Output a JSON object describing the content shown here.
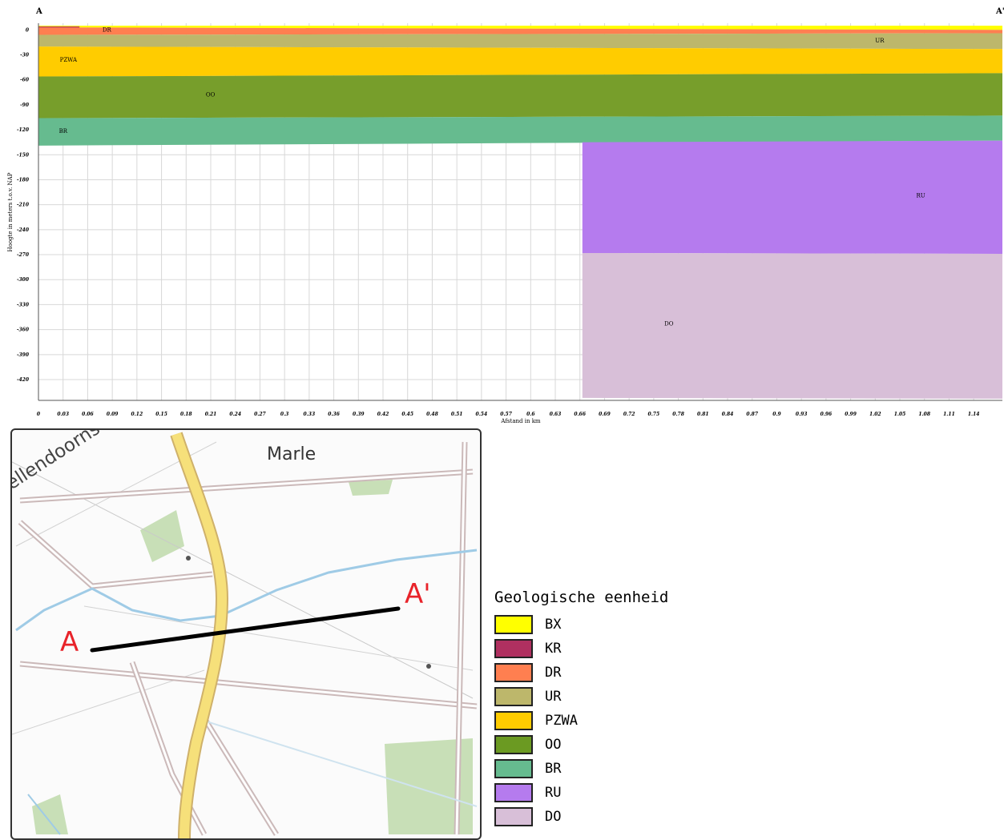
{
  "chart_data": {
    "type": "area",
    "title": "",
    "xlabel": "Afstand in km",
    "ylabel": "Hoogte in meters t.o.v. NAP",
    "xlim": [
      0,
      1.175
    ],
    "ylim": [
      -445,
      8
    ],
    "grid": true,
    "start_label": "A",
    "end_label": "A'",
    "x_ticks": [
      "0",
      "0.03",
      "0.06",
      "0.09",
      "0.12",
      "0.15",
      "0.18",
      "0.21",
      "0.24",
      "0.27",
      "0.3",
      "0.33",
      "0.36",
      "0.39",
      "0.42",
      "0.45",
      "0.48",
      "0.51",
      "0.54",
      "0.57",
      "0.6",
      "0.63",
      "0.66",
      "0.69",
      "0.72",
      "0.75",
      "0.78",
      "0.81",
      "0.84",
      "0.87",
      "0.9",
      "0.93",
      "0.96",
      "0.99",
      "1.02",
      "1.05",
      "1.08",
      "1.11",
      "1.14"
    ],
    "y_ticks": [
      "0",
      "-30",
      "-60",
      "-90",
      "-120",
      "-150",
      "-180",
      "-210",
      "-240",
      "-270",
      "-300",
      "-330",
      "-360",
      "-390",
      "-420"
    ],
    "units": [
      {
        "name": "BX",
        "color": "#ffff00",
        "x": [
          0,
          1.175
        ],
        "top": [
          5,
          5
        ],
        "bottom": [
          3,
          0
        ],
        "label": null
      },
      {
        "name": "KR",
        "color": "#b03060",
        "x": [
          0,
          0.05
        ],
        "top": [
          4,
          4
        ],
        "bottom": [
          -4,
          -4
        ],
        "label": null
      },
      {
        "name": "DR",
        "color": "#ff7f50",
        "x": [
          0,
          1.175
        ],
        "top": [
          3,
          0
        ],
        "bottom": [
          -6,
          -4
        ],
        "label": {
          "text": "DR",
          "x": 0.078,
          "y": -2
        }
      },
      {
        "name": "UR",
        "color": "#bdb76b",
        "x": [
          0,
          1.175
        ],
        "top": [
          -6,
          -4
        ],
        "bottom": [
          -20,
          -23
        ],
        "label": {
          "text": "UR",
          "x": 1.02,
          "y": -15
        }
      },
      {
        "name": "PZWA",
        "color": "#ffcc00",
        "x": [
          0,
          1.175
        ],
        "top": [
          -20,
          -23
        ],
        "bottom": [
          -56,
          -52
        ],
        "label": {
          "text": "PZWA",
          "x": 0.026,
          "y": -38
        }
      },
      {
        "name": "OO",
        "color": "#779e2b",
        "x": [
          0,
          1.175
        ],
        "top": [
          -56,
          -52
        ],
        "bottom": [
          -106,
          -103
        ],
        "label": {
          "text": "OO",
          "x": 0.204,
          "y": -80
        }
      },
      {
        "name": "BR",
        "color": "#66bb8f",
        "x": [
          0,
          1.175
        ],
        "top": [
          -106,
          -103
        ],
        "bottom": [
          -139,
          -133
        ],
        "label": {
          "text": "BR",
          "x": 0.025,
          "y": -124
        }
      },
      {
        "name": "RU",
        "color": "#b57bee",
        "x": [
          0.663,
          1.175
        ],
        "top": [
          -135,
          -133
        ],
        "bottom": [
          -268,
          -269
        ],
        "label": {
          "text": "RU",
          "x": 1.07,
          "y": -201
        }
      },
      {
        "name": "DO",
        "color": "#d8bfd8",
        "x": [
          0.663,
          1.175
        ],
        "top": [
          -268,
          -269
        ],
        "bottom": [
          -442,
          -443
        ],
        "label": {
          "text": "DO",
          "x": 0.763,
          "y": -355
        }
      }
    ]
  },
  "map": {
    "place_label": "Marle",
    "street_label": "Wellendoornseweg",
    "start_marker": "A",
    "end_marker": "A'"
  },
  "legend": {
    "title": "Geologische eenheid",
    "items": [
      {
        "label": "BX",
        "color": "#ffff00"
      },
      {
        "label": "KR",
        "color": "#b03060"
      },
      {
        "label": "DR",
        "color": "#ff7f50"
      },
      {
        "label": "UR",
        "color": "#bdb76b"
      },
      {
        "label": "PZWA",
        "color": "#ffcc00"
      },
      {
        "label": "OO",
        "color": "#6b9a22"
      },
      {
        "label": "BR",
        "color": "#66bb8f"
      },
      {
        "label": "RU",
        "color": "#b57bee"
      },
      {
        "label": "DO",
        "color": "#d8bfd8"
      }
    ]
  }
}
